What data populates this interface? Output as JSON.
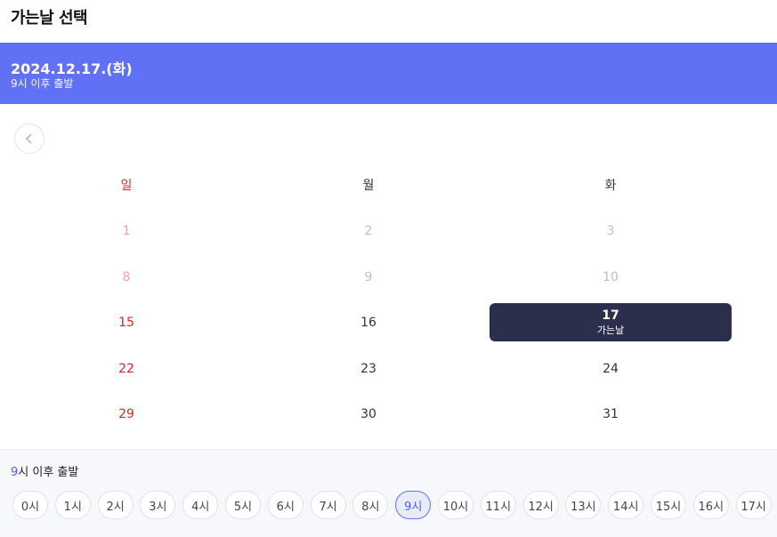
{
  "header": {
    "title": "가는날 선택"
  },
  "banner": {
    "date": "2024.12.17.(화)",
    "time_hour": "9",
    "time_suffix": "시 이후 출발"
  },
  "calendar": {
    "weekdays": [
      "일",
      "월",
      "화"
    ],
    "weeks": [
      [
        {
          "label": "1",
          "state": "past"
        },
        {
          "label": "2",
          "state": "past"
        },
        {
          "label": "3",
          "state": "past"
        }
      ],
      [
        {
          "label": "8",
          "state": "past"
        },
        {
          "label": "9",
          "state": "past"
        },
        {
          "label": "10",
          "state": "past"
        }
      ],
      [
        {
          "label": "15",
          "state": "normal"
        },
        {
          "label": "16",
          "state": "normal"
        },
        {
          "label": "17",
          "state": "selected",
          "sub": "가는날"
        }
      ],
      [
        {
          "label": "22",
          "state": "normal"
        },
        {
          "label": "23",
          "state": "normal"
        },
        {
          "label": "24",
          "state": "normal"
        }
      ],
      [
        {
          "label": "29",
          "state": "normal"
        },
        {
          "label": "30",
          "state": "normal"
        },
        {
          "label": "31",
          "state": "normal"
        }
      ]
    ]
  },
  "time_picker": {
    "label_hour": "9",
    "label_suffix": "시 이후 출발",
    "selected_index": 9,
    "hours": [
      "0시",
      "1시",
      "2시",
      "3시",
      "4시",
      "5시",
      "6시",
      "7시",
      "8시",
      "9시",
      "10시",
      "11시",
      "12시",
      "13시",
      "14시",
      "15시",
      "16시",
      "17시"
    ]
  },
  "colors": {
    "accent": "#6171f5",
    "selected_day": "#2c2f4b",
    "sunday": "#d9262c"
  },
  "icons": {
    "prev": "chevron-left-icon"
  }
}
